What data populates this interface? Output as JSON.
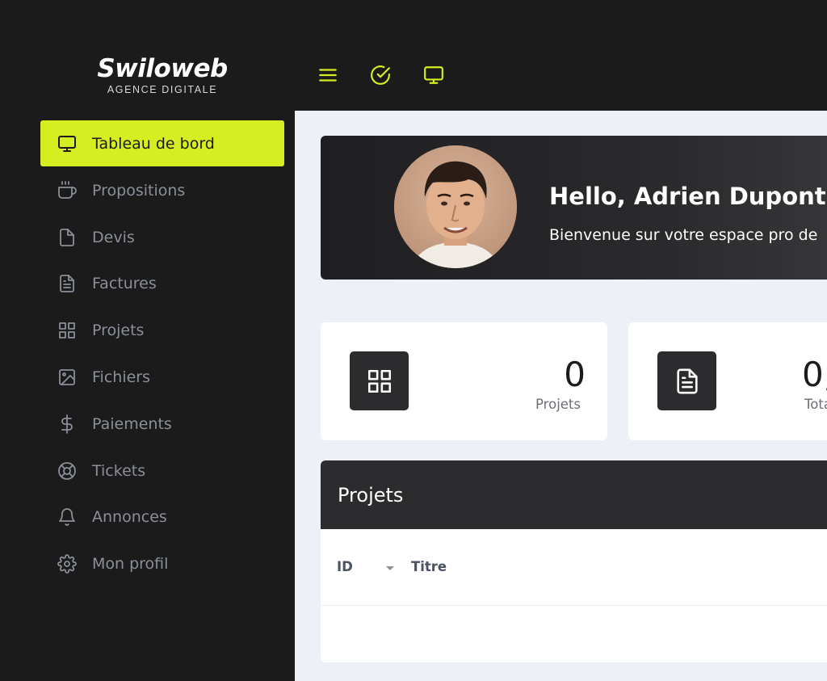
{
  "brand": {
    "name": "Swiloweb",
    "tagline": "AGENCE DIGITALE"
  },
  "sidebar": {
    "items": [
      {
        "label": "Tableau de bord",
        "icon": "monitor-icon",
        "active": true
      },
      {
        "label": "Propositions",
        "icon": "coffee-icon"
      },
      {
        "label": "Devis",
        "icon": "file-icon"
      },
      {
        "label": "Factures",
        "icon": "file-text-icon"
      },
      {
        "label": "Projets",
        "icon": "grid-icon"
      },
      {
        "label": "Fichiers",
        "icon": "image-icon"
      },
      {
        "label": "Paiements",
        "icon": "dollar-icon"
      },
      {
        "label": "Tickets",
        "icon": "life-buoy-icon"
      },
      {
        "label": "Annonces",
        "icon": "bell-icon"
      },
      {
        "label": "Mon profil",
        "icon": "settings-icon"
      }
    ]
  },
  "topbar": {
    "icons": [
      "menu-icon",
      "check-circle-icon",
      "monitor-icon"
    ]
  },
  "hero": {
    "greeting": "Hello, Adrien Dupont",
    "welcome": "Bienvenue sur votre espace pro de"
  },
  "stats": [
    {
      "value": "0",
      "label": "Projets",
      "icon": "grid-icon"
    },
    {
      "value": "0,",
      "label": "Tota",
      "icon": "file-text-icon"
    }
  ],
  "projects": {
    "title": "Projets",
    "columns": [
      "ID",
      "Titre"
    ]
  },
  "colors": {
    "accent": "#d4ee21",
    "sidebar_bg": "#1b1b1c",
    "main_bg": "#edf0f6",
    "dark_card": "#2c2c2e"
  }
}
